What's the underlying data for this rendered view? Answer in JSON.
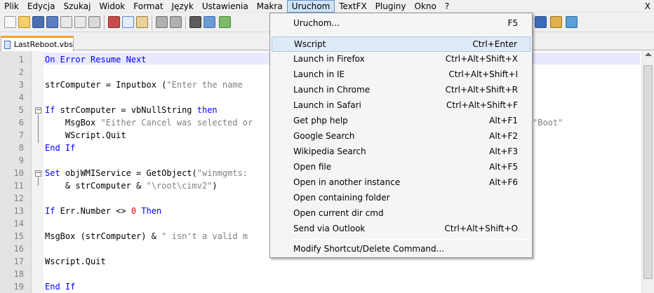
{
  "menubar": {
    "items": [
      "Plik",
      "Edycja",
      "Szukaj",
      "Widok",
      "Format",
      "Język",
      "Ustawienia",
      "Makra",
      "Uruchom",
      "TextFX",
      "Pluginy",
      "Okno",
      "?"
    ],
    "active_index": 8,
    "close_label": "X"
  },
  "tabs": [
    {
      "label": "LastReboot.vbs",
      "icon": "vbs-file-icon"
    }
  ],
  "editor": {
    "line_numbers": [
      "1",
      "2",
      "3",
      "4",
      "5",
      "6",
      "7",
      "8",
      "9",
      "10",
      "11",
      "12",
      "13",
      "14",
      "15",
      "16",
      "17",
      "18",
      "19"
    ],
    "lines": {
      "l1": "On Error Resume Next",
      "l3a": "strComputer = Inputbox (",
      "l3b": "\"Enter the name ",
      "l5a": "If",
      "l5b": " strComputer = vbNullString ",
      "l5c": "then",
      "l6a": "    MsgBox ",
      "l6b": "\"Either Cancel was selected or",
      "l6c": "\"Boot\"",
      "l7": "    WScript.Quit",
      "l8": "End If",
      "l10a": "Set",
      "l10b": " objWMIService = GetObject(",
      "l10c": "\"winmgmts:",
      "l11a": "    & strComputer & ",
      "l11b": "\"\\root\\cimv2\"",
      "l11c": ")",
      "l13a": "If",
      "l13b": " Err.Number <> ",
      "l13c": "0",
      "l13d": " Then",
      "l15a": "MsgBox (strComputer) & ",
      "l15b": "\" isn't a valid m",
      "l17": "Wscript.Quit",
      "l19": "End If"
    }
  },
  "dropdown": {
    "items": [
      {
        "label": "Uruchom...",
        "shortcut": "F5"
      },
      {
        "label": "Wscript",
        "shortcut": "Ctrl+Enter"
      },
      {
        "label": "Launch in Firefox",
        "shortcut": "Ctrl+Alt+Shift+X"
      },
      {
        "label": "Launch in IE",
        "shortcut": "Ctrl+Alt+Shift+I"
      },
      {
        "label": "Launch in Chrome",
        "shortcut": "Ctrl+Alt+Shift+R"
      },
      {
        "label": "Launch in Safari",
        "shortcut": "Ctrl+Alt+Shift+F"
      },
      {
        "label": "Get php help",
        "shortcut": "Alt+F1"
      },
      {
        "label": "Google Search",
        "shortcut": "Alt+F2"
      },
      {
        "label": "Wikipedia Search",
        "shortcut": "Alt+F3"
      },
      {
        "label": "Open file",
        "shortcut": "Alt+F5"
      },
      {
        "label": "Open in another instance",
        "shortcut": "Alt+F6"
      },
      {
        "label": "Open containing folder",
        "shortcut": ""
      },
      {
        "label": "Open current dir cmd",
        "shortcut": ""
      },
      {
        "label": "Send via Outlook",
        "shortcut": "Ctrl+Alt+Shift+O"
      },
      {
        "label": "Modify Shortcut/Delete Command...",
        "shortcut": ""
      }
    ],
    "highlighted_index": 1
  },
  "colors": {
    "keyword": "#0000ff",
    "string": "#808080",
    "number": "#ff0000",
    "tab_accent": "#f6a32c",
    "menu_highlight": "#dfeaf7"
  }
}
